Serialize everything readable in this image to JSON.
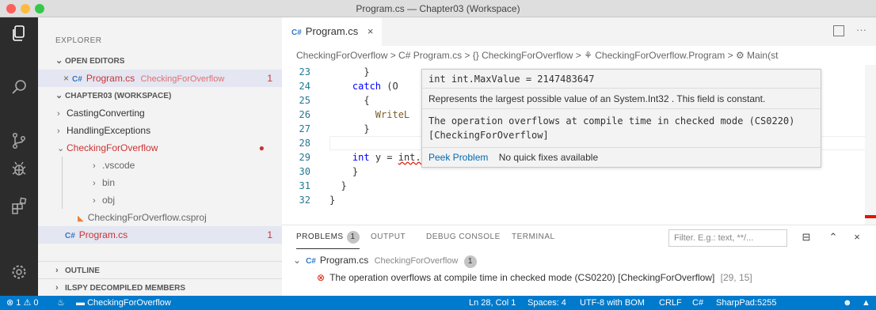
{
  "window": {
    "title": "Program.cs — Chapter03 (Workspace)"
  },
  "sidebar": {
    "title": "EXPLORER",
    "open_editors": {
      "label": "OPEN EDITORS",
      "file": "Program.cs",
      "folder": "CheckingForOverflow",
      "count": "1"
    },
    "workspace": {
      "label": "CHAPTER03 (WORKSPACE)",
      "items": {
        "casting": "CastingConverting",
        "handling": "HandlingExceptions",
        "checking": "CheckingForOverflow",
        "vscode": ".vscode",
        "bin": "bin",
        "obj": "obj",
        "csproj": "CheckingForOverflow.csproj",
        "program": "Program.cs",
        "program_count": "1"
      }
    },
    "outline": "OUTLINE",
    "ilspy": "ILSPY DECOMPILED MEMBERS"
  },
  "editor": {
    "tab": {
      "label": "Program.cs",
      "close": "×"
    },
    "breadcrumb": "CheckingForOverflow > C# Program.cs > {} CheckingForOverflow > ⚘ CheckingForOverflow.Program > ⚙ Main(st",
    "lines": [
      "23",
      "24",
      "25",
      "26",
      "27",
      "28",
      "29",
      "30",
      "31",
      "32"
    ],
    "code": {
      "l23": "      }",
      "l24_kw": "catch",
      "l24_rest": " (O",
      "l25": "      {",
      "l26_fn": "WriteL",
      "l27": "      }",
      "l29_kw": "int",
      "l29_a": " y = ",
      "l29_squig": "int.MaxValue + 1",
      "l29_end": ";",
      "l30": "    }",
      "l31": "  }",
      "l32": "}"
    }
  },
  "hover": {
    "signature": "int int.MaxValue = 2147483647",
    "doc": "Represents the largest possible value of an System.Int32 . This field is constant.",
    "error_line1": "The operation overflows at compile time in checked mode (CS0220)",
    "error_line2": "[CheckingForOverflow]",
    "peek": "Peek Problem",
    "no_fix": "No quick fixes available"
  },
  "panel": {
    "tabs": {
      "problems": "PROBLEMS",
      "problems_count": "1",
      "output": "OUTPUT",
      "debug": "DEBUG CONSOLE",
      "terminal": "TERMINAL"
    },
    "filter_placeholder": "Filter. E.g.: text, **/...",
    "file": "Program.cs",
    "folder": "CheckingForOverflow",
    "file_count": "1",
    "problem": "The operation overflows at compile time in checked mode (CS0220) [CheckingForOverflow]",
    "location": "[29, 15]"
  },
  "statusbar": {
    "errors": "1",
    "warnings": "0",
    "project": "CheckingForOverflow",
    "position": "Ln 28, Col 1",
    "spaces": "Spaces: 4",
    "encoding": "UTF-8 with BOM",
    "eol": "CRLF",
    "lang": "C#",
    "sharpad": "SharpPad:5255"
  },
  "colors": {
    "accent": "#007acc",
    "activity_bar": "#2c2c2c",
    "error": "#e51400",
    "link": "#006ab1"
  }
}
